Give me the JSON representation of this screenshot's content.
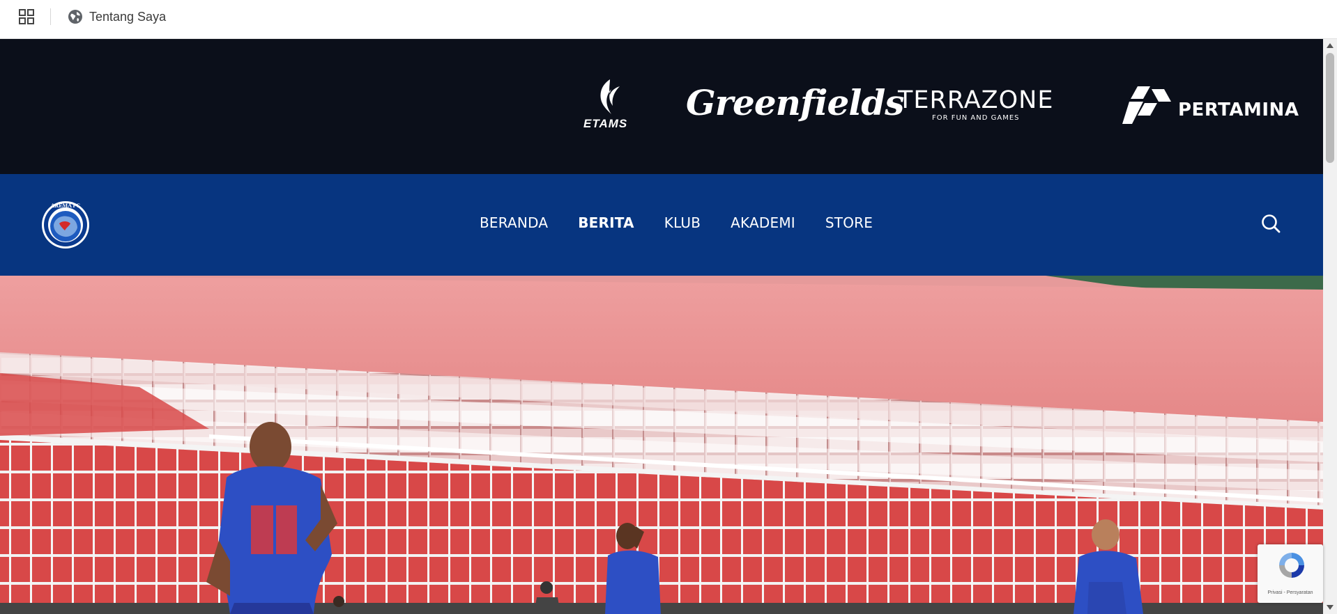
{
  "browser_bar": {
    "tab_label": "Tentang Saya",
    "apps_icon": "apps-grid-icon",
    "globe_icon": "globe-icon"
  },
  "sponsors": {
    "etams": "ETAMS",
    "greenfields": "Greenfields",
    "terrazone": "TERRAZONE",
    "terrazone_tagline": "FOR FUN AND GAMES",
    "pertamina": "PERTAMINA"
  },
  "nav": {
    "items": [
      {
        "label": "BERANDA",
        "active": false
      },
      {
        "label": "BERITA",
        "active": true
      },
      {
        "label": "KLUB",
        "active": false
      },
      {
        "label": "AKADEMI",
        "active": false
      },
      {
        "label": "STORE",
        "active": false
      }
    ],
    "search_icon": "search-icon",
    "logo_text": "AREMA FC"
  },
  "hero": {
    "alt": "Arema FC players on stadium pitch with numbered seats behind"
  },
  "recaptcha": {
    "links": "Privasi - Persyaratan"
  },
  "colors": {
    "sponsor_bg": "#0b0f1a",
    "nav_bg": "#073580",
    "wall": "#e89a9a",
    "jersey": "#2d4fc4"
  }
}
